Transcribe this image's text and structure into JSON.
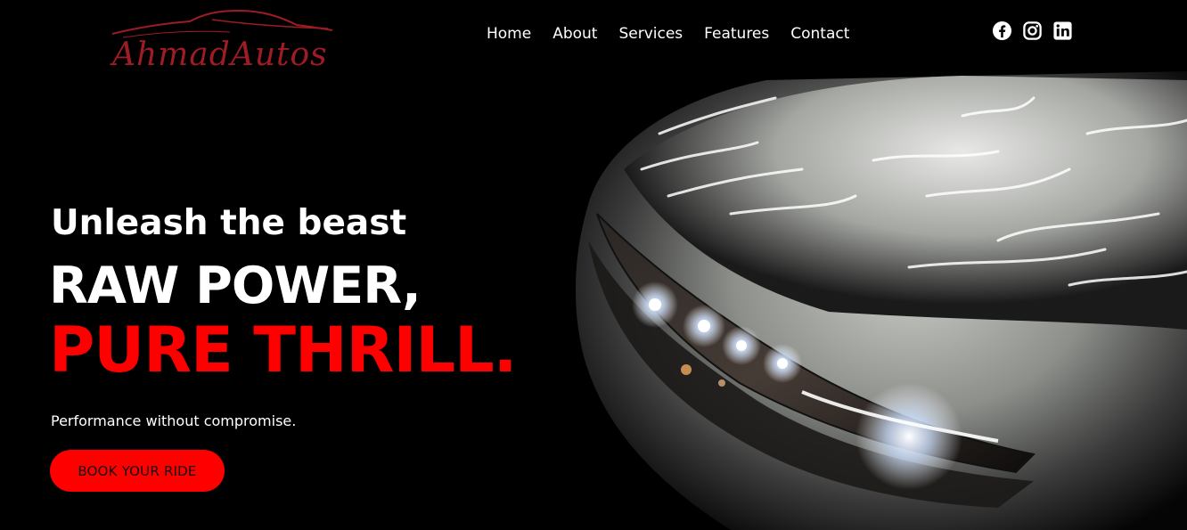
{
  "brand": {
    "logo_text": "AhmadAutos",
    "logo_color": "#9e1c24"
  },
  "nav": {
    "items": [
      {
        "label": "Home"
      },
      {
        "label": "About"
      },
      {
        "label": "Services"
      },
      {
        "label": "Features"
      },
      {
        "label": "Contact"
      }
    ]
  },
  "social": {
    "icons": [
      "facebook-icon",
      "instagram-icon",
      "linkedin-icon"
    ]
  },
  "hero": {
    "tagline": "Unleash the beast",
    "headline_line1": "RAW POWER,",
    "headline_line2": "PURE THRILL.",
    "subtitle": "Performance without compromise.",
    "cta_label": "BOOK YOUR RIDE"
  },
  "colors": {
    "accent": "#ff0000",
    "background": "#000000",
    "text": "#ffffff"
  }
}
